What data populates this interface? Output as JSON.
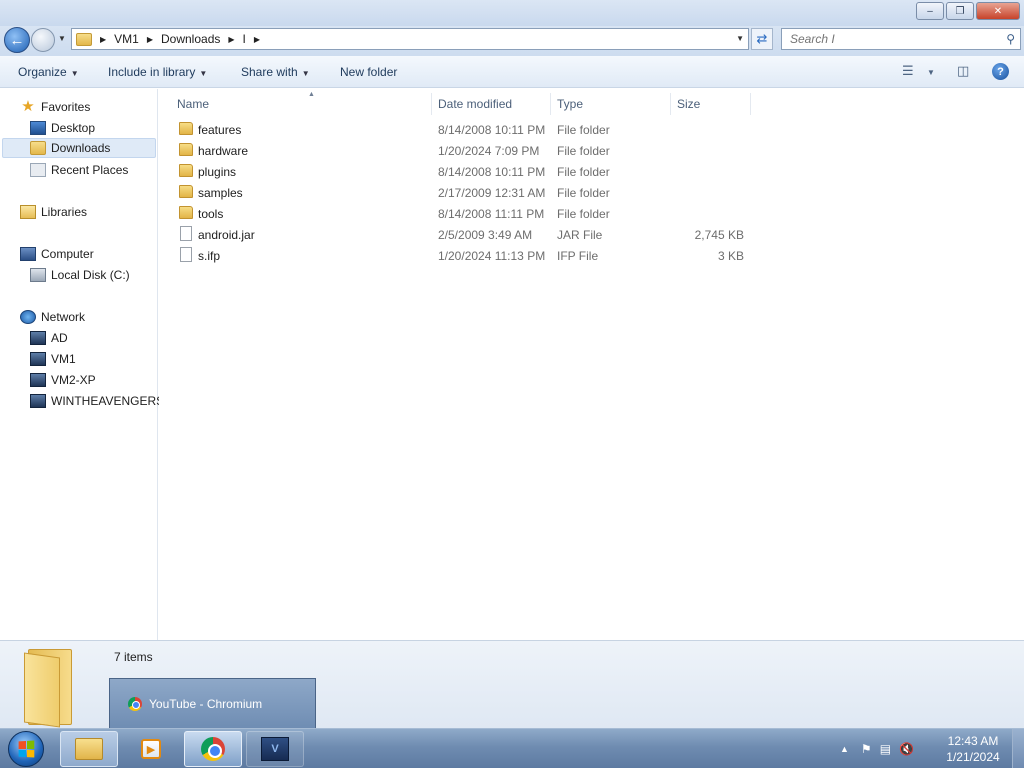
{
  "window": {
    "controls": {
      "minimize": "–",
      "maximize": "❐",
      "close": "✕"
    }
  },
  "address": {
    "crumbs": [
      "VM1",
      "Downloads",
      "I"
    ],
    "search_placeholder": "Search I"
  },
  "toolbar": {
    "organize": "Organize",
    "include_in_library": "Include in library",
    "share_with": "Share with",
    "new_folder": "New folder",
    "help": "?"
  },
  "nav": {
    "favorites": "Favorites",
    "desktop": "Desktop",
    "downloads": "Downloads",
    "recent_places": "Recent Places",
    "libraries": "Libraries",
    "computer": "Computer",
    "local_disk": "Local Disk (C:)",
    "network": "Network",
    "net_ad": "AD",
    "net_vm1": "VM1",
    "net_vm2": "VM2-XP",
    "net_win": "WINTHEAVENGERS"
  },
  "columns": {
    "name": "Name",
    "date": "Date modified",
    "type": "Type",
    "size": "Size"
  },
  "files": [
    {
      "name": "features",
      "date": "8/14/2008 10:11 PM",
      "type": "File folder",
      "size": "",
      "kind": "folder"
    },
    {
      "name": "hardware",
      "date": "1/20/2024 7:09 PM",
      "type": "File folder",
      "size": "",
      "kind": "folder"
    },
    {
      "name": "plugins",
      "date": "8/14/2008 10:11 PM",
      "type": "File folder",
      "size": "",
      "kind": "folder"
    },
    {
      "name": "samples",
      "date": "2/17/2009 12:31 AM",
      "type": "File folder",
      "size": "",
      "kind": "folder"
    },
    {
      "name": "tools",
      "date": "8/14/2008 11:11 PM",
      "type": "File folder",
      "size": "",
      "kind": "folder"
    },
    {
      "name": "android.jar",
      "date": "2/5/2009 3:49 AM",
      "type": "JAR File",
      "size": "2,745 KB",
      "kind": "file"
    },
    {
      "name": "s.ifp",
      "date": "1/20/2024 11:13 PM",
      "type": "IFP File",
      "size": "3 KB",
      "kind": "file"
    }
  ],
  "details": {
    "items_count": "7 items"
  },
  "taskbar": {
    "preview_title": "YouTube - Chromium",
    "clock_time": "12:43 AM",
    "clock_date": "1/21/2024"
  }
}
